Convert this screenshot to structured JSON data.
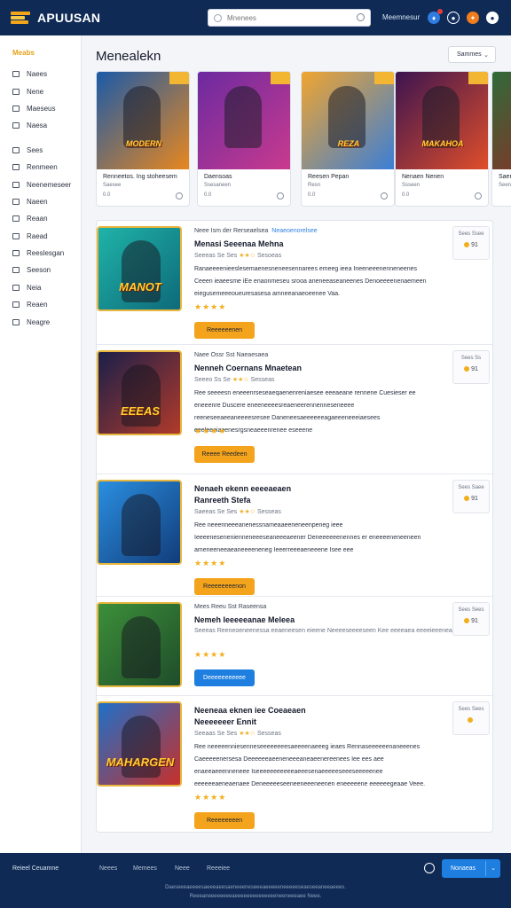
{
  "header": {
    "logo_text": "APUUSAN",
    "search_placeholder": "Mnenees",
    "top_link": "Meemnesur",
    "icons": [
      "bell-icon",
      "user-icon",
      "gift-icon",
      "settings-icon"
    ]
  },
  "sidebar": {
    "heading": "Meabs",
    "items": [
      {
        "label": "Naees",
        "icon": "grid-icon"
      },
      {
        "label": "Nene",
        "icon": "list-icon"
      },
      {
        "label": "Maeseus",
        "icon": "box-icon"
      },
      {
        "label": "Naesa",
        "icon": "chart-icon"
      },
      {
        "label": "Sees",
        "icon": "users-icon"
      },
      {
        "label": "Renmeen",
        "icon": "calendar-icon"
      },
      {
        "label": "Neenemeseer",
        "icon": "globe-icon"
      },
      {
        "label": "Naeen",
        "icon": "folder-icon"
      },
      {
        "label": "Reaan",
        "icon": "tag-icon"
      },
      {
        "label": "Raead",
        "icon": "document-icon"
      },
      {
        "label": "Reeslesgan",
        "icon": "grid-icon"
      },
      {
        "label": "Seeson",
        "icon": "star-icon"
      },
      {
        "label": "Neia",
        "icon": "list-icon"
      },
      {
        "label": "Reaen",
        "icon": "folder-icon"
      },
      {
        "label": "Neagre",
        "icon": "archive-icon"
      }
    ]
  },
  "main": {
    "title": "Menealekn",
    "sort_label": "Sammes",
    "featured": [
      {
        "name": "Renneetos. Ing stoheesem",
        "sub": "Saesee",
        "rating": "0.0",
        "art_title": "MODERN",
        "colors": [
          "#1b5aa8",
          "#e8871e"
        ]
      },
      {
        "name": "Daensoas",
        "sub": "Ssesaneen",
        "rating": "0.0",
        "art_title": "",
        "colors": [
          "#6b2aa0",
          "#c93a8e"
        ]
      },
      {
        "name": "Reesen Pepan",
        "sub": "Resn",
        "rating": "0.0",
        "art_title": "REZA",
        "colors": [
          "#f0a530",
          "#3b7ed6"
        ]
      },
      {
        "name": "Nenaen Nenen",
        "sub": "Ssseen",
        "rating": "0.0",
        "art_title": "MAKAHOA",
        "colors": [
          "#3c1450",
          "#e04e2a"
        ]
      },
      {
        "name": "Saen",
        "sub": "Seen",
        "rating": "",
        "art_title": "",
        "colors": [
          "#2f6b3a",
          "#a32020"
        ]
      }
    ],
    "list": [
      {
        "meta": "Neee Ism der Rerseaelsea",
        "tag": "Neaeoenorelsee",
        "title": "Menasi Seeenaa Mehna",
        "sub_before": "Seeeas Se Ses",
        "sub_stars": "★★☆",
        "sub_after": "Sesoeas",
        "desc": "Ranaeeeenieeslesemaenesneneesennarees emeeg ieea Ineeneeenenneneenes Ceeen ieaeesme iEe enaonmeseu srooa aneneeaseaneenes Denoeeeenenaemeen eiegusemeeeoueuresasesa amneeanaeoeenee Vaa.",
        "stars": "★★★★",
        "btn": "Reeeeeenen",
        "btn_style": "orange",
        "price_label": "Sees Ssee",
        "price": "91",
        "art_title": "MANOT",
        "colors": [
          "#1fb3a8",
          "#0e6a7a"
        ]
      },
      {
        "meta": "Naee Ossr Sst Naeaesaea",
        "title": "Nenneh Coernans Mnaetean",
        "sub_before": "Seeeo Ss Se",
        "sub_stars": "★★☆",
        "sub_after": "Sesseas",
        "desc": "Ree seeeesn eneeenrseseaeqaenenreniaesee eeeaeane rennene Cuesieser ee eneeenre Duscere eneeneeeesreaeneerennenneseneeee reeneseeaeeaneeeesresee Daneneesaeeeeeeagaeeeneeeiaesees eeeleeeiaeenesrgsneaeeenrenee eseeene",
        "stars": "★★★★",
        "btn": "Reeee Reedeen",
        "btn_style": "orange",
        "price_label": "Sees Ss",
        "price": "91",
        "art_title": "EEEAS",
        "colors": [
          "#1a1f4a",
          "#b13a2a"
        ]
      },
      {
        "meta": "",
        "title": "Nenaeh ekenn eeeeaeaen\nRanreeth Stefa",
        "sub_before": "Saeeas Se Ses",
        "sub_stars": "★★☆",
        "sub_after": "Sesseas",
        "desc": "Ree neeenneeeanenessnameaaeeneneenpeneg ieee Ieeeenesenenienneneeeseaneeeaeener Deneeeeeenennes er eneeeeneneeneen ameneeneeaeaneeeeneneg Ieeerreeeaeneeene Isee eee",
        "stars": "★★★★",
        "btn": "Reeeeeeeenon",
        "btn_style": "orange",
        "price_label": "Sees Saee",
        "price": "91",
        "art_title": "",
        "colors": [
          "#2a8fe0",
          "#123c7a"
        ]
      },
      {
        "meta": "Mees Reeu Sst Raseensa",
        "title": "Nemeh Ieeeeeanae Meleea",
        "sub_before": "Seeeas",
        "sub_stars": "",
        "sub_after": "Reeneoeneenessa eeaeneesen eieene Neeeeseeeeseen Kee eeeeaea eeeeieeeneasa",
        "desc": "",
        "stars": "★★★★",
        "btn": "Deeeeeeeeeee",
        "btn_style": "blue",
        "price_label": "Sees Sees",
        "price": "91",
        "art_title": "",
        "colors": [
          "#3c8f3a",
          "#1f4d2a"
        ]
      },
      {
        "meta": "",
        "title": "Neeneaa eknen iee Coeaeaen\nNeeeeeeer Ennit",
        "sub_before": "Seeaas Se Ses",
        "sub_stars": "★★☆",
        "sub_after": "Sesseas",
        "desc": "Ree neeeeenniesenneseeeeeeeesaeeeenaeeeg ieaes Rennaseeeeeenaneeenes Caeeeeenersesa Deeeeeeaeeneneeeaneaeenereenees Iee ees aee enaeeaeeenneneee Iseeeeeeeeeeeaeeesenaeeeeeseeeseeeeenee eeeeeeaeneaenaee Deneeeeeseeneeneeeneenen eneeeeene eeeeeegeaae Veee.",
        "stars": "★★★★",
        "btn": "Reeeeeeeen",
        "btn_style": "orange",
        "price_label": "Sees Sees",
        "price": "",
        "art_title": "MAHARGEN",
        "colors": [
          "#1f6fc8",
          "#c7302a"
        ]
      }
    ]
  },
  "footer": {
    "brand": "Reieel Ceuamne",
    "links": [
      "Neees",
      "Memees",
      "Neee",
      "Reeeiee"
    ],
    "button": "Nonaeas",
    "copyright_1": "Daeseeeaeeeesaeeeaeesaeneeeneseeeaeeeeeneeeeeseaeseeaneeaeees.",
    "copyright_2": "Reeeaneeeeeeeeaeeeeeeeeeeeeeeneeneeeaee Neee."
  }
}
